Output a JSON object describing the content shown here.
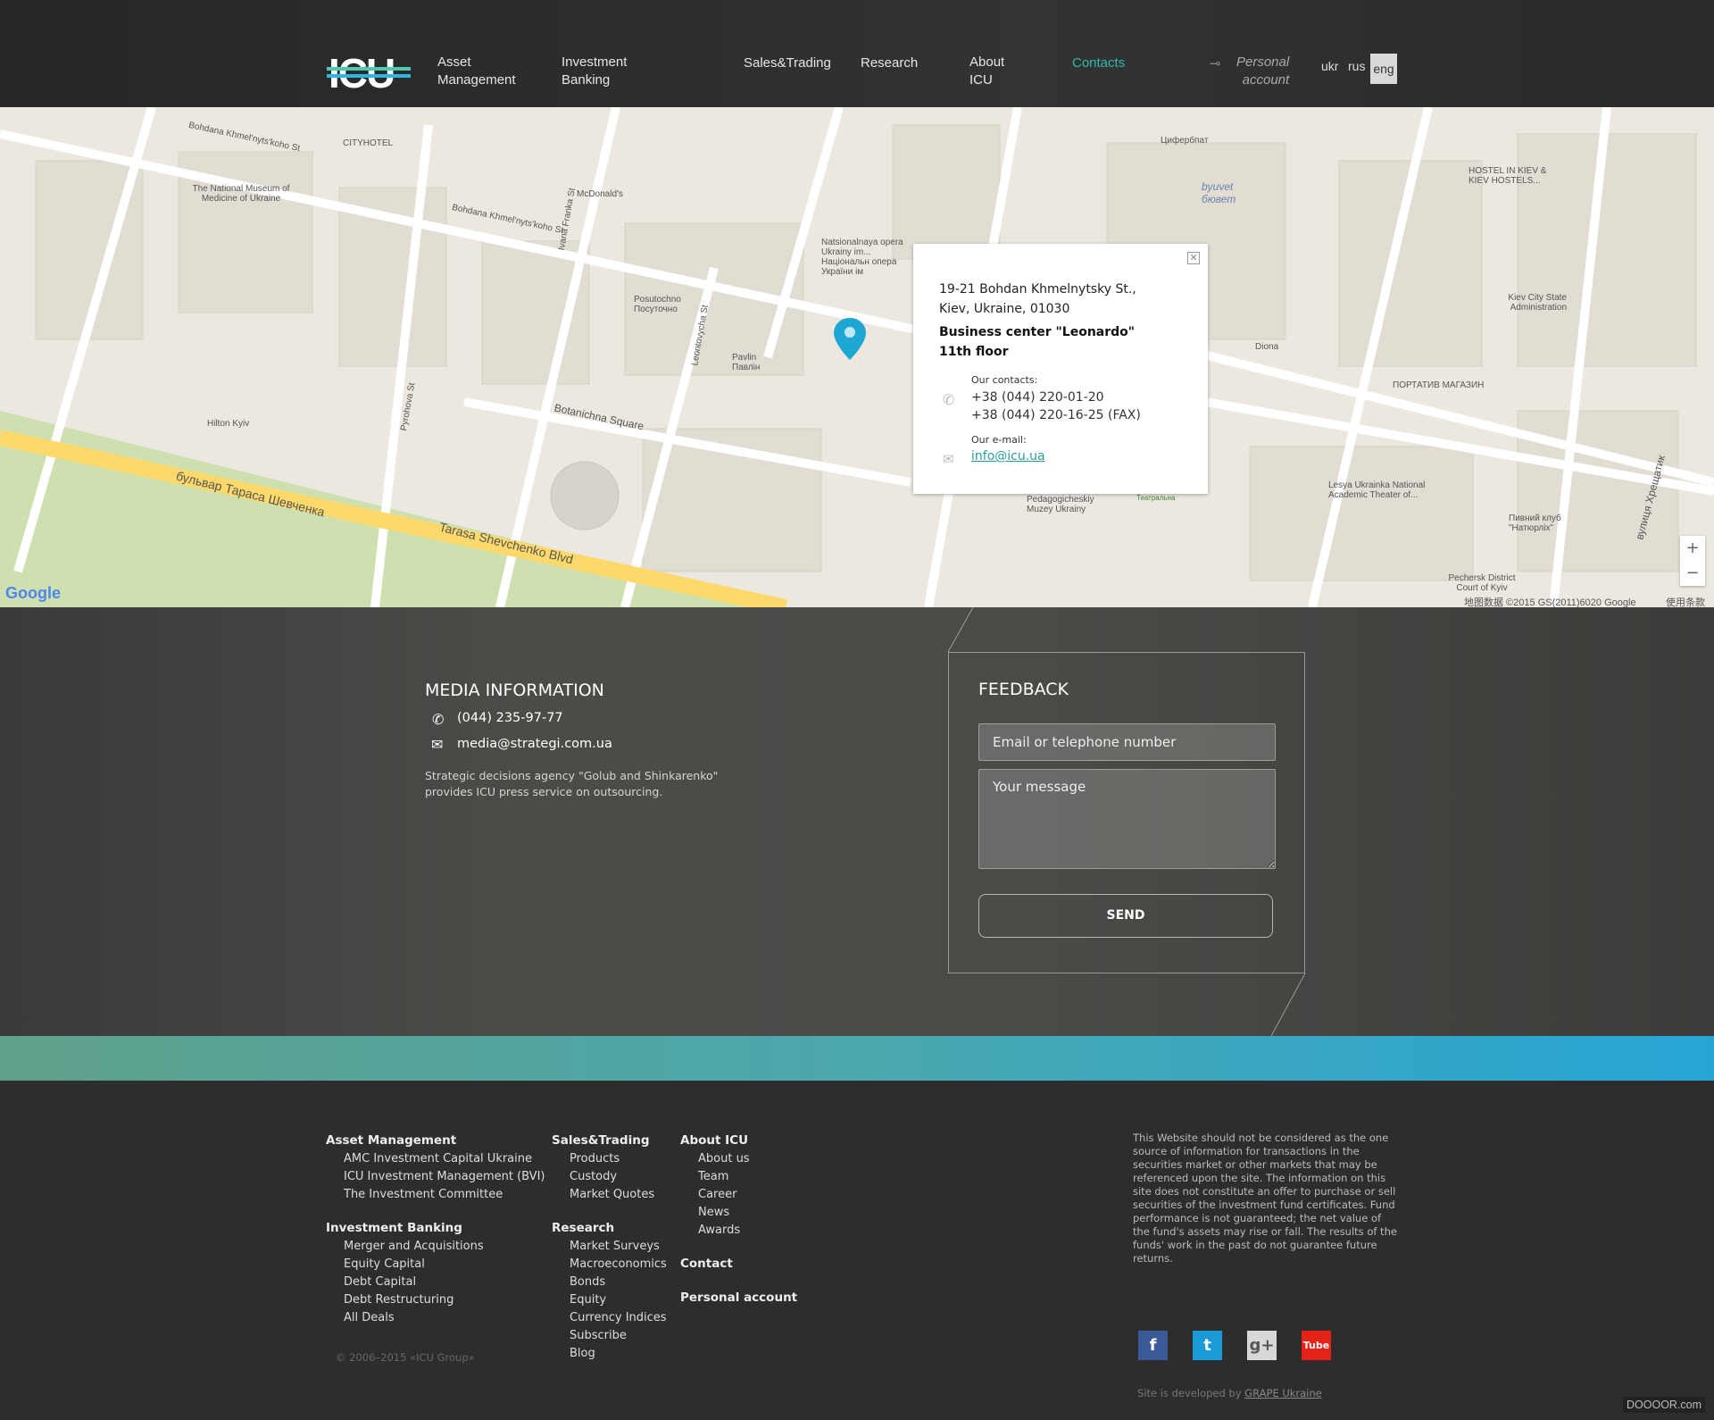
{
  "header": {
    "logo_text": "ICU",
    "nav": [
      {
        "label_line1": "Asset",
        "label_line2": "Management"
      },
      {
        "label_line1": "Investment",
        "label_line2": "Banking"
      },
      {
        "label_line1": "Sales&Trading",
        "label_line2": ""
      },
      {
        "label_line1": "Research",
        "label_line2": ""
      },
      {
        "label_line1": "About",
        "label_line2": "ICU"
      },
      {
        "label_line1": "Contacts",
        "label_line2": ""
      }
    ],
    "personal_account": {
      "line1": "Personal",
      "line2": "account",
      "icon": "key-icon"
    },
    "languages": [
      "ukr",
      "rus",
      "eng"
    ],
    "active_language": "eng",
    "accent_color": "#2fb9a6"
  },
  "map": {
    "labels": [
      "Bohdana Khmel'nyts'koho St",
      "Tarasa Shevchenko Blvd",
      "бульвар Тараса Шевченка",
      "Botanichna Square",
      "Ivana Franka St",
      "Pyrohova St",
      "Leontovycha St",
      "Hilton Kyiv",
      "CITYHOTEL",
      "McDonald's",
      "Posutochno Посуточно",
      "Pavlin Павлін",
      "Natsionalnaya opera Ukrainy im... Національн опера України ім",
      "The National Museum of Medicine of Ukraine",
      "Цифербпат",
      "byuvet бювет",
      "HOSTEL IN KIEV & KIEV HOSTELS...",
      "Kiev City State Administration",
      "Diona",
      "ПОРТАТИВ МАГАЗИН",
      "Lesya Ukrainka National Academic Theater of...",
      "Pedagogicheskiy Muzey Ukrainy",
      "Pechersk District Court of Kyiv",
      "Пивний клуб \"Натюрліх\"",
      "вулиця Хрещатик",
      "Театральна"
    ],
    "google": "Google",
    "attribution": "地图数据 ©2015 GS(2011)6020 Google",
    "terms": "使用条款",
    "zoom_in": "+",
    "zoom_out": "−",
    "popup": {
      "address_line1": "19-21 Bohdan Khmelnytsky St.,",
      "address_line2": "Kiev, Ukraine, 01030",
      "building_line1": "Business center \"Leonardo\"",
      "building_line2": "11th floor",
      "contacts_label": "Our contacts:",
      "phone1": "+38 (044) 220-01-20",
      "phone2": "+38 (044) 220-16-25 (FAX)",
      "email_label": "Our e-mail:",
      "email": "info@icu.ua"
    }
  },
  "media": {
    "title": "MEDIA INFORMATION",
    "phone": "(044) 235-97-77",
    "email": "media@strategi.com.ua",
    "note_line1": "Strategic decisions agency \"Golub and Shinkarenko\"",
    "note_line2": "provides ICU press service on outsourcing."
  },
  "feedback": {
    "title": "FEEDBACK",
    "contact_placeholder": "Email or telephone number",
    "message_placeholder": "Your message",
    "send_label": "SEND"
  },
  "footer": {
    "columns": [
      {
        "groups": [
          {
            "heading": "Asset Management",
            "items": [
              "AMC Investment Capital Ukraine",
              "ICU Investment Management (BVI)",
              "The Investment Committee"
            ]
          },
          {
            "heading": "Investment Banking",
            "items": [
              "Merger and Acquisitions",
              "Equity Capital",
              "Debt Capital",
              "Debt Restructuring",
              "All Deals"
            ]
          }
        ]
      },
      {
        "groups": [
          {
            "heading": "Sales&Trading",
            "items": [
              "Products",
              "Custody",
              "Market Quotes"
            ]
          },
          {
            "heading": "Research",
            "items": [
              "Market Surveys",
              "Macroeconomics",
              "Bonds",
              "Equity",
              "Currency Indices",
              "Subscribe",
              "Blog"
            ]
          }
        ]
      },
      {
        "groups": [
          {
            "heading": "About ICU",
            "items": [
              "About us",
              "Team",
              "Career",
              "News",
              "Awards"
            ]
          },
          {
            "heading": "Contact",
            "items": []
          },
          {
            "heading": "Personal account",
            "items": []
          }
        ]
      }
    ],
    "copyright": "© 2006–2015 «ICU Group»",
    "disclaimer": "This Website should not be considered as the one source of information for transactions in the securities market or other markets that may be referenced upon the site. The information on this site does not constitute an offer to purchase or sell securities of the investment fund certificates. Fund performance is not guaranteed; the net value of the fund's assets may rise or fall. The results of the funds' work in the past do not guarantee future returns.",
    "social": [
      {
        "icon": "facebook-icon",
        "glyph": "f",
        "color": "#3b5998"
      },
      {
        "icon": "twitter-icon",
        "glyph": "t",
        "color": "#1a9bd7"
      },
      {
        "icon": "google-plus-icon",
        "glyph": "g+",
        "color": "#d8d8d8"
      },
      {
        "icon": "youtube-icon",
        "glyph": "Tube",
        "color": "#e62117"
      }
    ],
    "developed_by": "Site is developed by",
    "developer": "GRAPE Ukraine",
    "watermark": "DOOOOR.com"
  }
}
